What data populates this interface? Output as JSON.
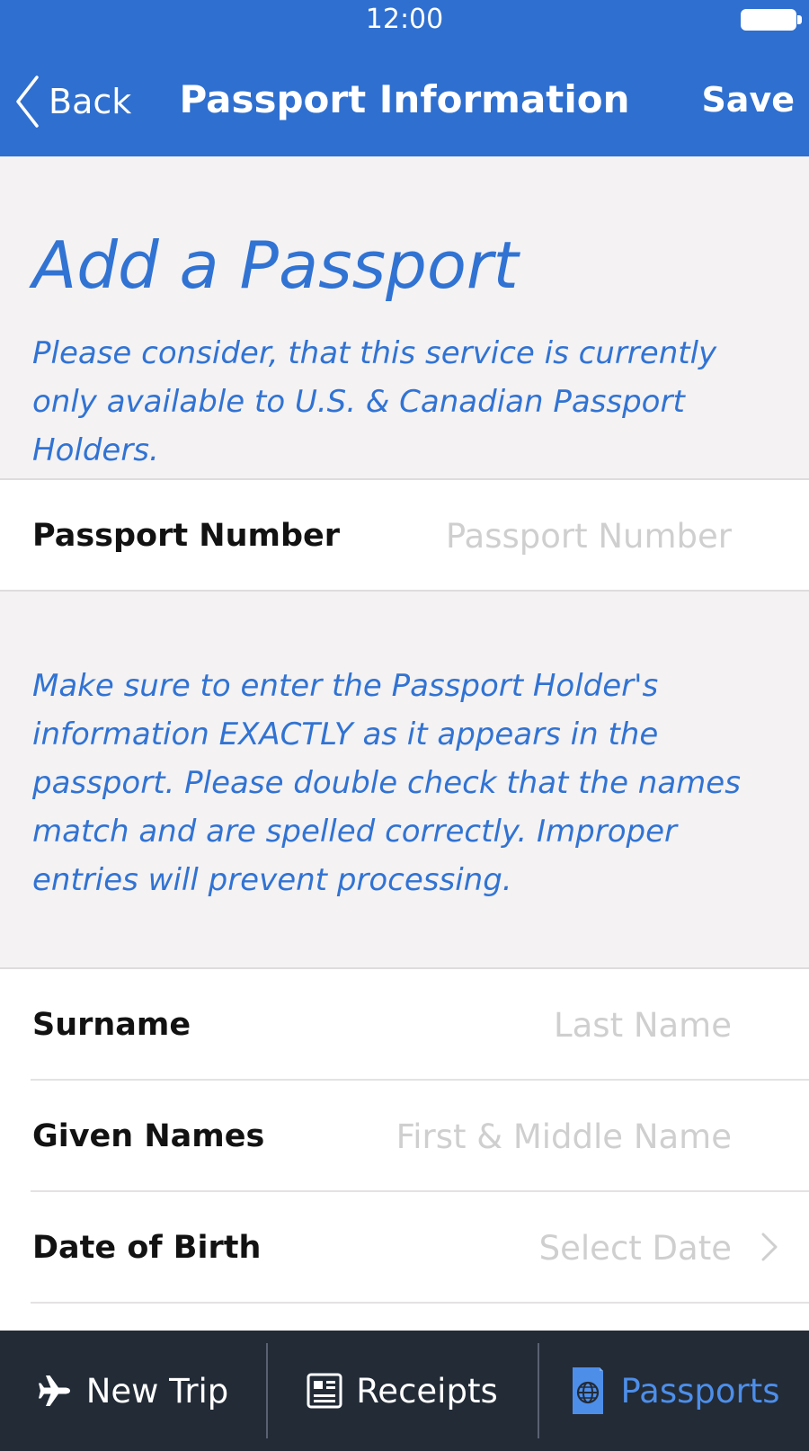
{
  "status_bar": {
    "time": "12:00"
  },
  "header": {
    "back_label": "Back",
    "title": "Passport Information",
    "save_label": "Save"
  },
  "intro": {
    "heading": "Add a Passport",
    "notice": "Please consider, that this service is currently only available to U.S. & Canadian Passport Holders."
  },
  "passport_number": {
    "label": "Passport Number",
    "placeholder": "Passport Number",
    "value": ""
  },
  "instructions": {
    "text": "Make sure to enter the Passport Holder's information EXACTLY as it appears in the passport.  Please double check that the names match and are spelled correctly. Improper entries will prevent processing."
  },
  "holder_fields": [
    {
      "label": "Surname",
      "placeholder": "Last Name",
      "value": ""
    },
    {
      "label": "Given Names",
      "placeholder": "First & Middle Name",
      "value": ""
    },
    {
      "label": "Date of Birth",
      "value": "Select Date"
    }
  ],
  "tabbar": {
    "items": [
      {
        "label": "New Trip",
        "icon": "airplane-icon",
        "active": false
      },
      {
        "label": "Receipts",
        "icon": "receipt-icon",
        "active": false
      },
      {
        "label": "Passports",
        "icon": "passport-icon",
        "active": true
      }
    ]
  },
  "colors": {
    "brand_blue": "#2f6fcf",
    "accent_text_blue": "#3173d3",
    "tabbar_bg": "#222b36",
    "tab_active": "#4d8ee9",
    "background": "#f4f2f3",
    "placeholder": "#cfcfcf"
  }
}
